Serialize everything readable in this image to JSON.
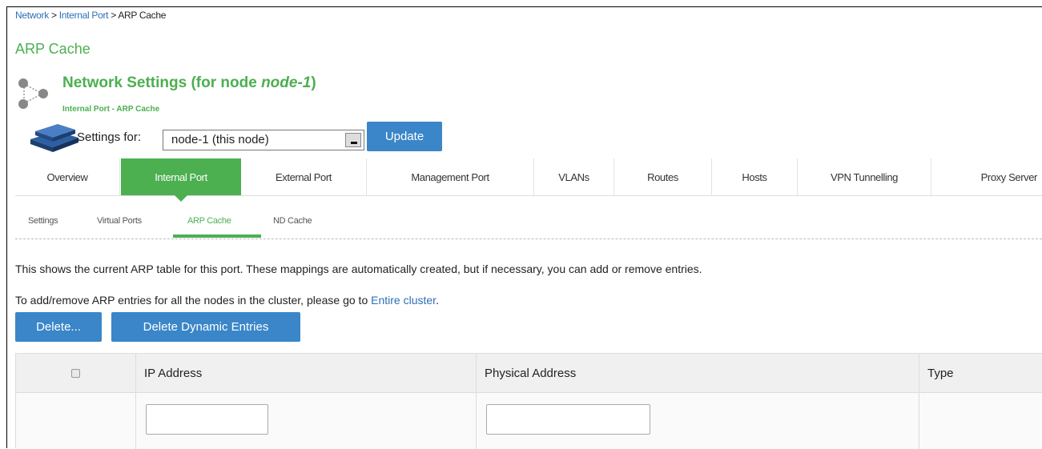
{
  "breadcrumb": {
    "items": [
      "Network",
      "Internal Port"
    ],
    "separator": ">",
    "current": "ARP Cache"
  },
  "page_title": "ARP Cache",
  "header": {
    "title_prefix": "Network Settings (for node ",
    "title_node": "node-1",
    "title_suffix": ")",
    "subtitle": "Internal Port - ARP Cache"
  },
  "settings": {
    "label": "Settings for:",
    "selected_node": "node-1 (this node)",
    "update_label": "Update"
  },
  "tabs": [
    "Overview",
    "Internal Port",
    "External Port",
    "Management Port",
    "VLANs",
    "Routes",
    "Hosts",
    "VPN Tunnelling",
    "Proxy Server"
  ],
  "active_tab": "Internal Port",
  "subtabs": [
    "Settings",
    "Virtual Ports",
    "ARP Cache",
    "ND Cache"
  ],
  "active_subtab": "ARP Cache",
  "description": {
    "line1": "This shows the current ARP table for this port. These mappings are automatically created, but if necessary, you can add or remove entries.",
    "line2_prefix": "To add/remove ARP entries for all the nodes in the cluster, please go to ",
    "line2_link": "Entire cluster",
    "line2_suffix": "."
  },
  "actions": {
    "delete_label": "Delete...",
    "delete_dynamic_label": "Delete Dynamic Entries"
  },
  "table": {
    "columns": [
      "IP Address",
      "Physical Address",
      "Type"
    ],
    "inputs": {
      "ip": "",
      "physical": ""
    }
  },
  "colors": {
    "accent_green": "#4caf50",
    "button_blue": "#3a86c8",
    "link_blue": "#2f6fb5"
  },
  "icons": {
    "node": "network-node-icon",
    "settings": "server-stack-icon",
    "select_all": "checkbox-icon",
    "dropdown": "chevron-down-icon"
  }
}
